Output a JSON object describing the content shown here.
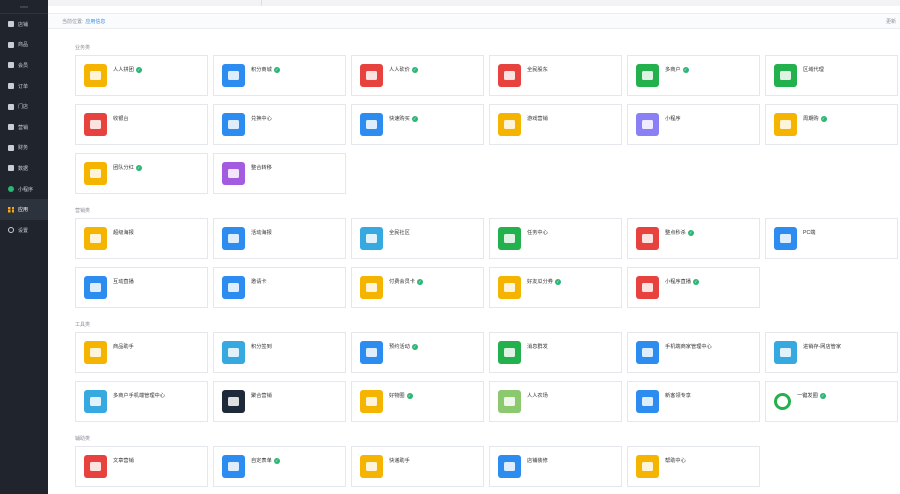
{
  "sidebar": {
    "items": [
      {
        "label": "店铺",
        "icon": "shop-icon",
        "icon_class": "ic-sq",
        "active": false
      },
      {
        "label": "商品",
        "icon": "goods-icon",
        "icon_class": "ic-sq",
        "active": false
      },
      {
        "label": "会员",
        "icon": "member-icon",
        "icon_class": "ic-sq",
        "active": false
      },
      {
        "label": "订单",
        "icon": "order-icon",
        "icon_class": "ic-sq",
        "active": false
      },
      {
        "label": "门店",
        "icon": "store-icon",
        "icon_class": "ic-sq",
        "active": false
      },
      {
        "label": "营销",
        "icon": "marketing-icon",
        "icon_class": "ic-sq",
        "active": false
      },
      {
        "label": "财务",
        "icon": "finance-icon",
        "icon_class": "ic-sq",
        "active": false
      },
      {
        "label": "数据",
        "icon": "data-icon",
        "icon_class": "ic-sq",
        "active": false
      },
      {
        "label": "小程序",
        "icon": "miniprogram-icon",
        "icon_class": "ic-circle",
        "active": false
      },
      {
        "label": "应用",
        "icon": "apps-grid-icon",
        "icon_class": "ic-grid",
        "active": true
      },
      {
        "label": "设置",
        "icon": "settings-gear-icon",
        "icon_class": "ic-gear",
        "active": false
      }
    ]
  },
  "breadcrumb": {
    "prefix": "当前位置:",
    "current": "应用信息"
  },
  "header_right": "更新",
  "sections": [
    {
      "title": "业务类",
      "apps": [
        {
          "label": "人人拼团",
          "color": "#f5b400",
          "check": true
        },
        {
          "label": "积分商城",
          "color": "#2d8cf0",
          "check": true
        },
        {
          "label": "人人砍价",
          "color": "#e8423f",
          "check": true
        },
        {
          "label": "全民股东",
          "color": "#e8423f",
          "check": false
        },
        {
          "label": "多商户",
          "color": "#23b14d",
          "check": true
        },
        {
          "label": "区域代理",
          "color": "#23b14d",
          "check": false
        },
        {
          "label": "收银台",
          "color": "#e8423f",
          "check": false
        },
        {
          "label": "兑换中心",
          "color": "#2d8cf0",
          "check": false
        },
        {
          "label": "快速购买",
          "color": "#2d8cf0",
          "check": true
        },
        {
          "label": "游戏营销",
          "color": "#f5b400",
          "check": false
        },
        {
          "label": "小程序",
          "color": "#8b7ff5",
          "check": false
        },
        {
          "label": "周期购",
          "color": "#f5b400",
          "check": true
        },
        {
          "label": "团队分红",
          "color": "#f5b400",
          "check": true
        },
        {
          "label": "整合转移",
          "color": "#a35be0",
          "check": false
        }
      ]
    },
    {
      "title": "营销类",
      "apps": [
        {
          "label": "超级海报",
          "color": "#f5b400",
          "check": false
        },
        {
          "label": "活动海报",
          "color": "#2d8cf0",
          "check": false
        },
        {
          "label": "全民社区",
          "color": "#36a9e1",
          "check": false
        },
        {
          "label": "任务中心",
          "color": "#23b14d",
          "check": false
        },
        {
          "label": "整点秒杀",
          "color": "#e8423f",
          "check": true
        },
        {
          "label": "PC端",
          "color": "#2d8cf0",
          "check": false
        },
        {
          "label": "互动直播",
          "color": "#2d8cf0",
          "check": false
        },
        {
          "label": "邀请卡",
          "color": "#2d8cf0",
          "check": false
        },
        {
          "label": "付费会员卡",
          "color": "#f5b400",
          "check": true
        },
        {
          "label": "好友瓜分券",
          "color": "#f5b400",
          "check": true
        },
        {
          "label": "小程序直播",
          "color": "#e8423f",
          "check": true
        }
      ]
    },
    {
      "title": "工具类",
      "apps": [
        {
          "label": "商品助手",
          "color": "#f5b400",
          "check": false
        },
        {
          "label": "积分签到",
          "color": "#36a9e1",
          "check": false
        },
        {
          "label": "预约活动",
          "color": "#2d8cf0",
          "check": true
        },
        {
          "label": "消息群发",
          "color": "#23b14d",
          "check": false
        },
        {
          "label": "手机端商家管理中心",
          "color": "#2d8cf0",
          "check": false
        },
        {
          "label": "进销存-网店管家",
          "color": "#36a9e1",
          "check": false
        },
        {
          "label": "多商户手机端管理中心",
          "color": "#36a9e1",
          "check": false
        },
        {
          "label": "聚合营销",
          "color": "#1e2a3a",
          "check": false
        },
        {
          "label": "好物圈",
          "color": "#f5b400",
          "check": true
        },
        {
          "label": "人人农场",
          "color": "#8cc86e",
          "check": false
        },
        {
          "label": "新客领专享",
          "color": "#2d8cf0",
          "check": false
        },
        {
          "label": "一键发圈",
          "color": "#ffffff",
          "check": true
        }
      ]
    },
    {
      "title": "辅助类",
      "apps": [
        {
          "label": "文章营销",
          "color": "#e8423f",
          "check": false
        },
        {
          "label": "自定表单",
          "color": "#2d8cf0",
          "check": true
        },
        {
          "label": "快递助手",
          "color": "#f5b400",
          "check": false
        },
        {
          "label": "店铺装修",
          "color": "#2d8cf0",
          "check": false
        },
        {
          "label": "帮助中心",
          "color": "#f5b400",
          "check": false
        }
      ]
    }
  ]
}
